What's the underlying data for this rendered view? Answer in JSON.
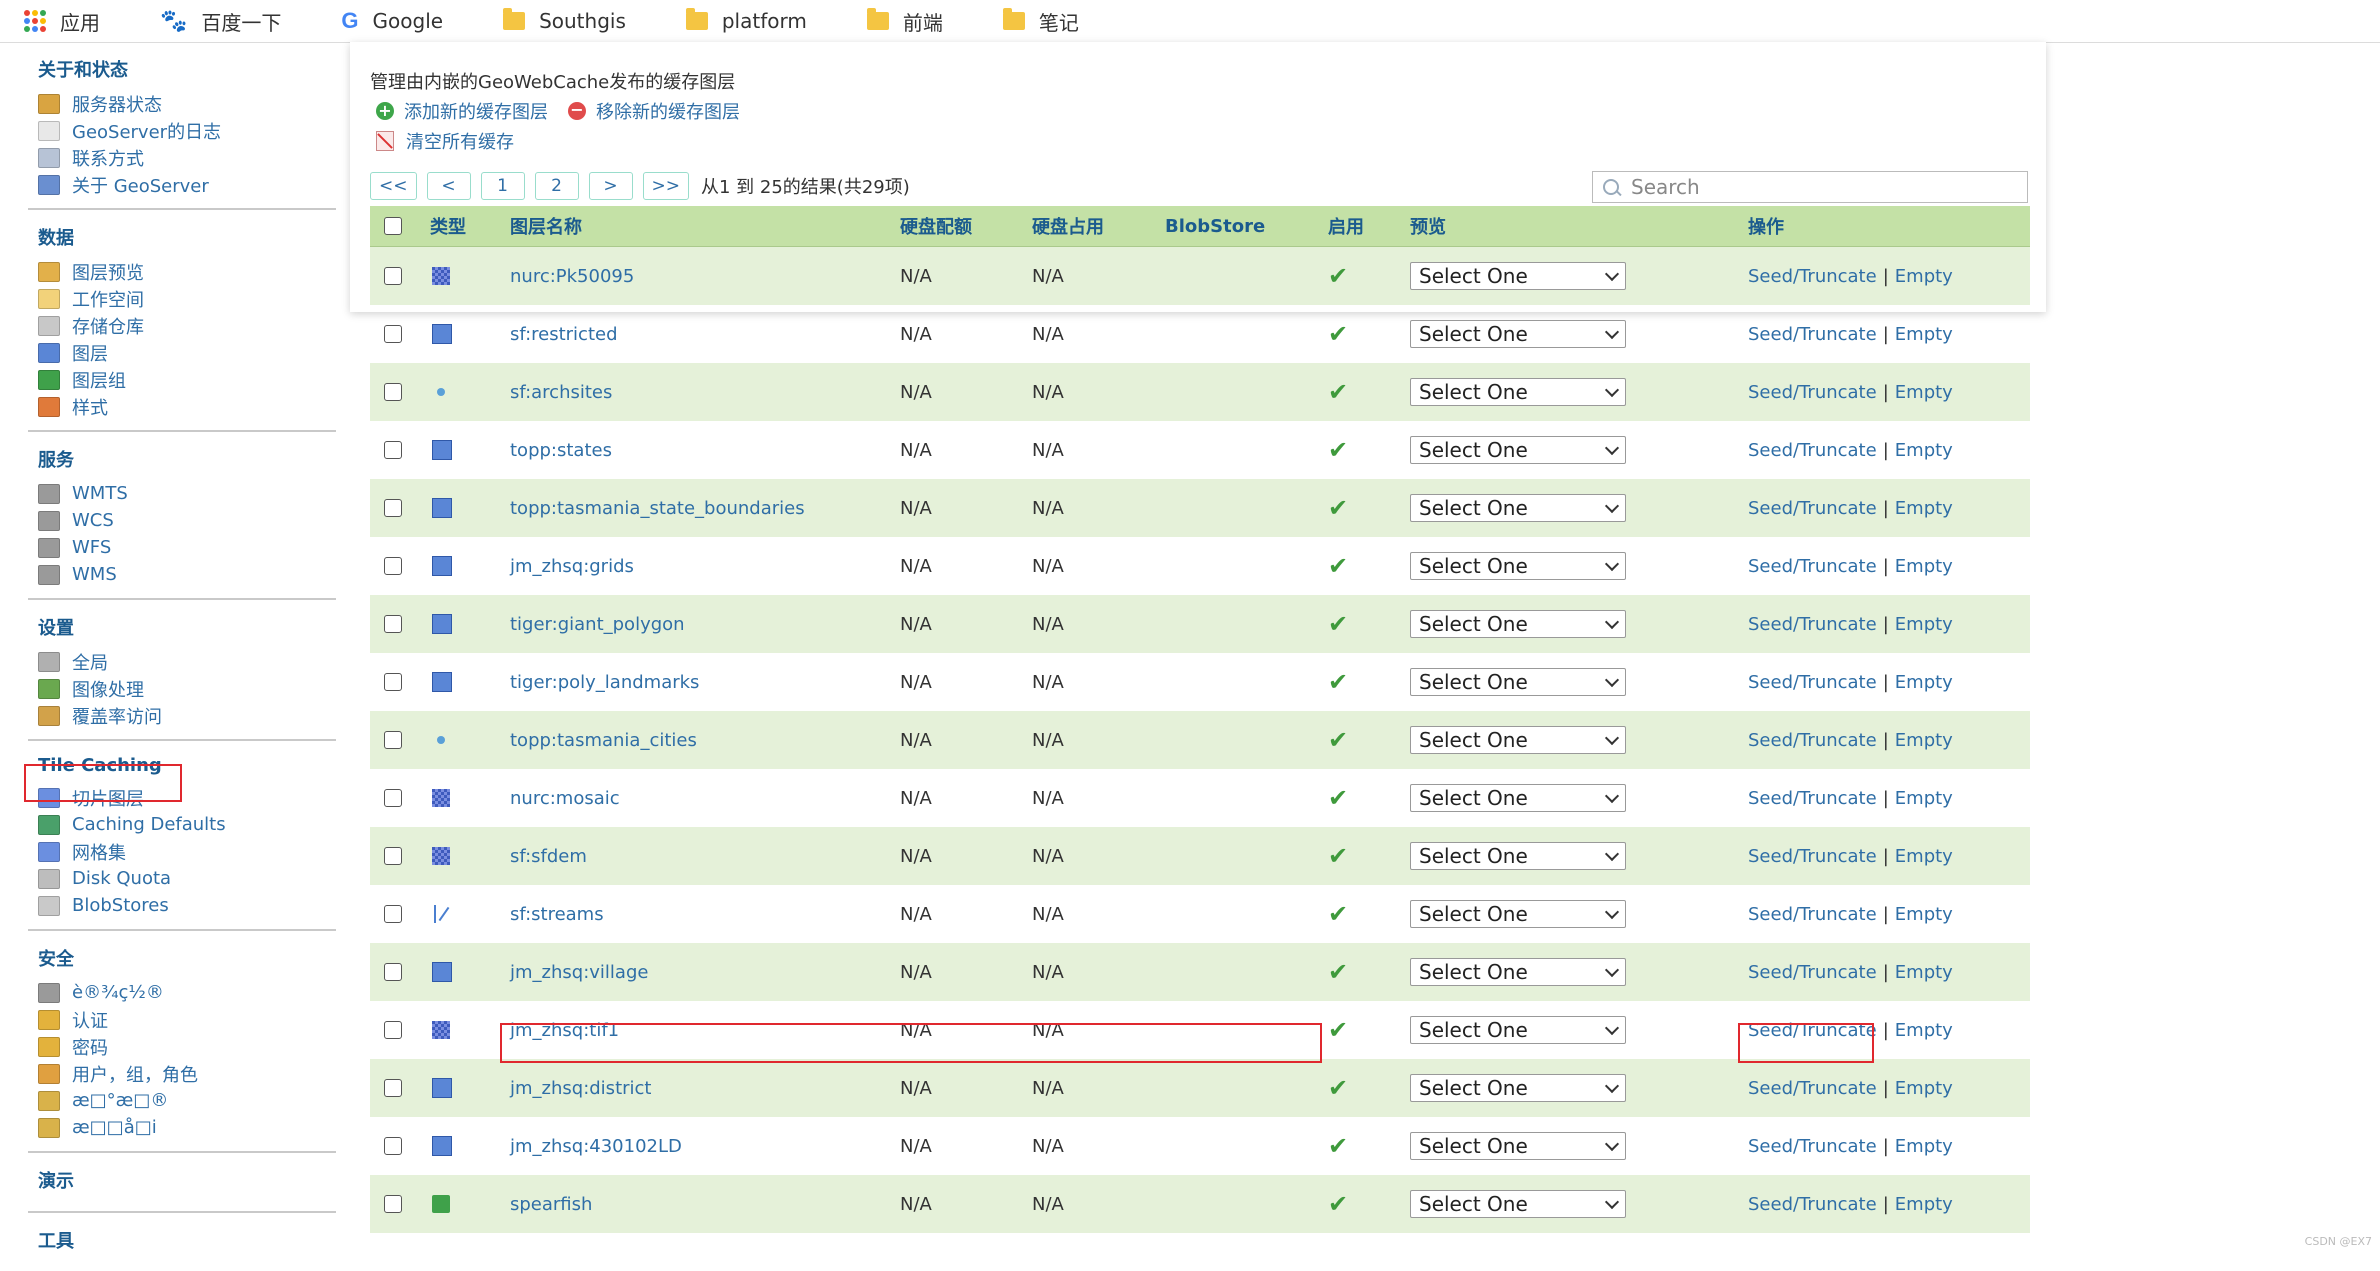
{
  "bookmarks": {
    "items": [
      {
        "label": "应用",
        "icon": "apps-icon"
      },
      {
        "label": "百度一下",
        "icon": "baidu-icon"
      },
      {
        "label": "Google",
        "icon": "google-icon"
      },
      {
        "label": "Southgis",
        "icon": "folder-icon"
      },
      {
        "label": "platform",
        "icon": "folder-icon"
      },
      {
        "label": "前端",
        "icon": "folder-icon"
      },
      {
        "label": "笔记",
        "icon": "folder-icon"
      }
    ]
  },
  "sidebar": {
    "sections": [
      {
        "title": "关于和状态",
        "items": [
          {
            "label": "服务器状态",
            "icon": "server-status-icon",
            "color": "#d9a441"
          },
          {
            "label": "GeoServer的日志",
            "icon": "log-icon",
            "color": "#e8e8e8"
          },
          {
            "label": "联系方式",
            "icon": "contact-icon",
            "color": "#b7c3d6"
          },
          {
            "label": "关于 GeoServer",
            "icon": "about-icon",
            "color": "#6a8fd0"
          }
        ]
      },
      {
        "title": "数据",
        "items": [
          {
            "label": "图层预览",
            "icon": "layer-preview-icon",
            "color": "#e2b04a"
          },
          {
            "label": "工作空间",
            "icon": "workspace-icon",
            "color": "#f2d27a"
          },
          {
            "label": "存储仓库",
            "icon": "store-icon",
            "color": "#c8c8c8"
          },
          {
            "label": "图层",
            "icon": "layer-icon",
            "color": "#5a86d6"
          },
          {
            "label": "图层组",
            "icon": "layer-group-icon",
            "color": "#3fa14a"
          },
          {
            "label": "样式",
            "icon": "style-icon",
            "color": "#e07a3a"
          }
        ]
      },
      {
        "title": "服务",
        "items": [
          {
            "label": "WMTS",
            "icon": "service-icon",
            "color": "#9a9a9a"
          },
          {
            "label": "WCS",
            "icon": "service-icon",
            "color": "#9a9a9a"
          },
          {
            "label": "WFS",
            "icon": "service-icon",
            "color": "#9a9a9a"
          },
          {
            "label": "WMS",
            "icon": "service-icon",
            "color": "#9a9a9a"
          }
        ]
      },
      {
        "title": "设置",
        "items": [
          {
            "label": "全局",
            "icon": "global-settings-icon",
            "color": "#b0b0b0"
          },
          {
            "label": "图像处理",
            "icon": "image-processing-icon",
            "color": "#6aa84f"
          },
          {
            "label": "覆盖率访问",
            "icon": "coverage-access-icon",
            "color": "#d2a24a"
          }
        ]
      },
      {
        "title": "Tile Caching",
        "items": [
          {
            "label": "切片图层",
            "icon": "tile-layers-icon",
            "color": "#6b8fe0"
          },
          {
            "label": "Caching Defaults",
            "icon": "globe-icon",
            "color": "#4aa06a"
          },
          {
            "label": "网格集",
            "icon": "gridset-icon",
            "color": "#6b8fe0"
          },
          {
            "label": "Disk Quota",
            "icon": "disk-icon",
            "color": "#bdbdbd"
          },
          {
            "label": "BlobStores",
            "icon": "blobstore-icon",
            "color": "#c9c9c9"
          }
        ]
      },
      {
        "title": "安全",
        "items": [
          {
            "label": "è®¾ç½®",
            "icon": "key-icon",
            "color": "#9a9a9a"
          },
          {
            "label": "认证",
            "icon": "shield-icon",
            "color": "#e3b23c"
          },
          {
            "label": "密码",
            "icon": "lock-icon",
            "color": "#e3b23c"
          },
          {
            "label": "用户，组，角色",
            "icon": "users-icon",
            "color": "#e0a040"
          },
          {
            "label": "æ□°æ□®",
            "icon": "data-security-icon",
            "color": "#d9b24a"
          },
          {
            "label": "æ□□å□i",
            "icon": "service-security-icon",
            "color": "#d9b24a"
          }
        ]
      },
      {
        "title": "演示",
        "items": []
      },
      {
        "title": "工具",
        "items": []
      }
    ]
  },
  "content": {
    "description": "管理由内嵌的GeoWebCache发布的缓存图层",
    "add_link": "添加新的缓存图层",
    "remove_link": "移除新的缓存图层",
    "clear_link": "清空所有缓存",
    "pager": {
      "first": "<<",
      "prev": "<",
      "pages": [
        "1",
        "2"
      ],
      "next": ">",
      "last": ">>",
      "info": "从1 到 25的结果(共29项)"
    },
    "search_placeholder": "Search"
  },
  "table": {
    "headers": {
      "type": "类型",
      "name": "图层名称",
      "quota": "硬盘配额",
      "usage": "硬盘占用",
      "blobstore": "BlobStore",
      "enabled": "启用",
      "preview": "预览",
      "actions": "操作"
    },
    "rows": [
      {
        "type": "raster",
        "name": "nurc:Pk50095",
        "quota": "N/A",
        "usage": "N/A",
        "preview": "Select One",
        "seed": "Seed/Truncate",
        "empty": "Empty"
      },
      {
        "type": "polygon",
        "name": "sf:restricted",
        "quota": "N/A",
        "usage": "N/A",
        "preview": "Select One",
        "seed": "Seed/Truncate",
        "empty": "Empty"
      },
      {
        "type": "point",
        "name": "sf:archsites",
        "quota": "N/A",
        "usage": "N/A",
        "preview": "Select One",
        "seed": "Seed/Truncate",
        "empty": "Empty"
      },
      {
        "type": "polygon",
        "name": "topp:states",
        "quota": "N/A",
        "usage": "N/A",
        "preview": "Select One",
        "seed": "Seed/Truncate",
        "empty": "Empty"
      },
      {
        "type": "polygon",
        "name": "topp:tasmania_state_boundaries",
        "quota": "N/A",
        "usage": "N/A",
        "preview": "Select One",
        "seed": "Seed/Truncate",
        "empty": "Empty"
      },
      {
        "type": "polygon",
        "name": "jm_zhsq:grids",
        "quota": "N/A",
        "usage": "N/A",
        "preview": "Select One",
        "seed": "Seed/Truncate",
        "empty": "Empty"
      },
      {
        "type": "polygon",
        "name": "tiger:giant_polygon",
        "quota": "N/A",
        "usage": "N/A",
        "preview": "Select One",
        "seed": "Seed/Truncate",
        "empty": "Empty"
      },
      {
        "type": "polygon",
        "name": "tiger:poly_landmarks",
        "quota": "N/A",
        "usage": "N/A",
        "preview": "Select One",
        "seed": "Seed/Truncate",
        "empty": "Empty"
      },
      {
        "type": "point",
        "name": "topp:tasmania_cities",
        "quota": "N/A",
        "usage": "N/A",
        "preview": "Select One",
        "seed": "Seed/Truncate",
        "empty": "Empty"
      },
      {
        "type": "raster",
        "name": "nurc:mosaic",
        "quota": "N/A",
        "usage": "N/A",
        "preview": "Select One",
        "seed": "Seed/Truncate",
        "empty": "Empty"
      },
      {
        "type": "raster",
        "name": "sf:sfdem",
        "quota": "N/A",
        "usage": "N/A",
        "preview": "Select One",
        "seed": "Seed/Truncate",
        "empty": "Empty"
      },
      {
        "type": "line",
        "name": "sf:streams",
        "quota": "N/A",
        "usage": "N/A",
        "preview": "Select One",
        "seed": "Seed/Truncate",
        "empty": "Empty"
      },
      {
        "type": "polygon",
        "name": "jm_zhsq:village",
        "quota": "N/A",
        "usage": "N/A",
        "preview": "Select One",
        "seed": "Seed/Truncate",
        "empty": "Empty"
      },
      {
        "type": "raster",
        "name": "jm_zhsq:tif1",
        "quota": "N/A",
        "usage": "N/A",
        "preview": "Select One",
        "seed": "Seed/Truncate",
        "empty": "Empty"
      },
      {
        "type": "polygon",
        "name": "jm_zhsq:district",
        "quota": "N/A",
        "usage": "N/A",
        "preview": "Select One",
        "seed": "Seed/Truncate",
        "empty": "Empty"
      },
      {
        "type": "polygon",
        "name": "jm_zhsq:430102LD",
        "quota": "N/A",
        "usage": "N/A",
        "preview": "Select One",
        "seed": "Seed/Truncate",
        "empty": "Empty"
      },
      {
        "type": "group",
        "name": "spearfish",
        "quota": "N/A",
        "usage": "N/A",
        "preview": "Select One",
        "seed": "Seed/Truncate",
        "empty": "Empty"
      }
    ]
  },
  "watermark": "CSDN @EX7",
  "colors": {
    "header_bg": "#c4e1a6",
    "row_alt_bg": "#e5f1d9",
    "link": "#2f6ea6",
    "highlight": "#e0282e"
  }
}
